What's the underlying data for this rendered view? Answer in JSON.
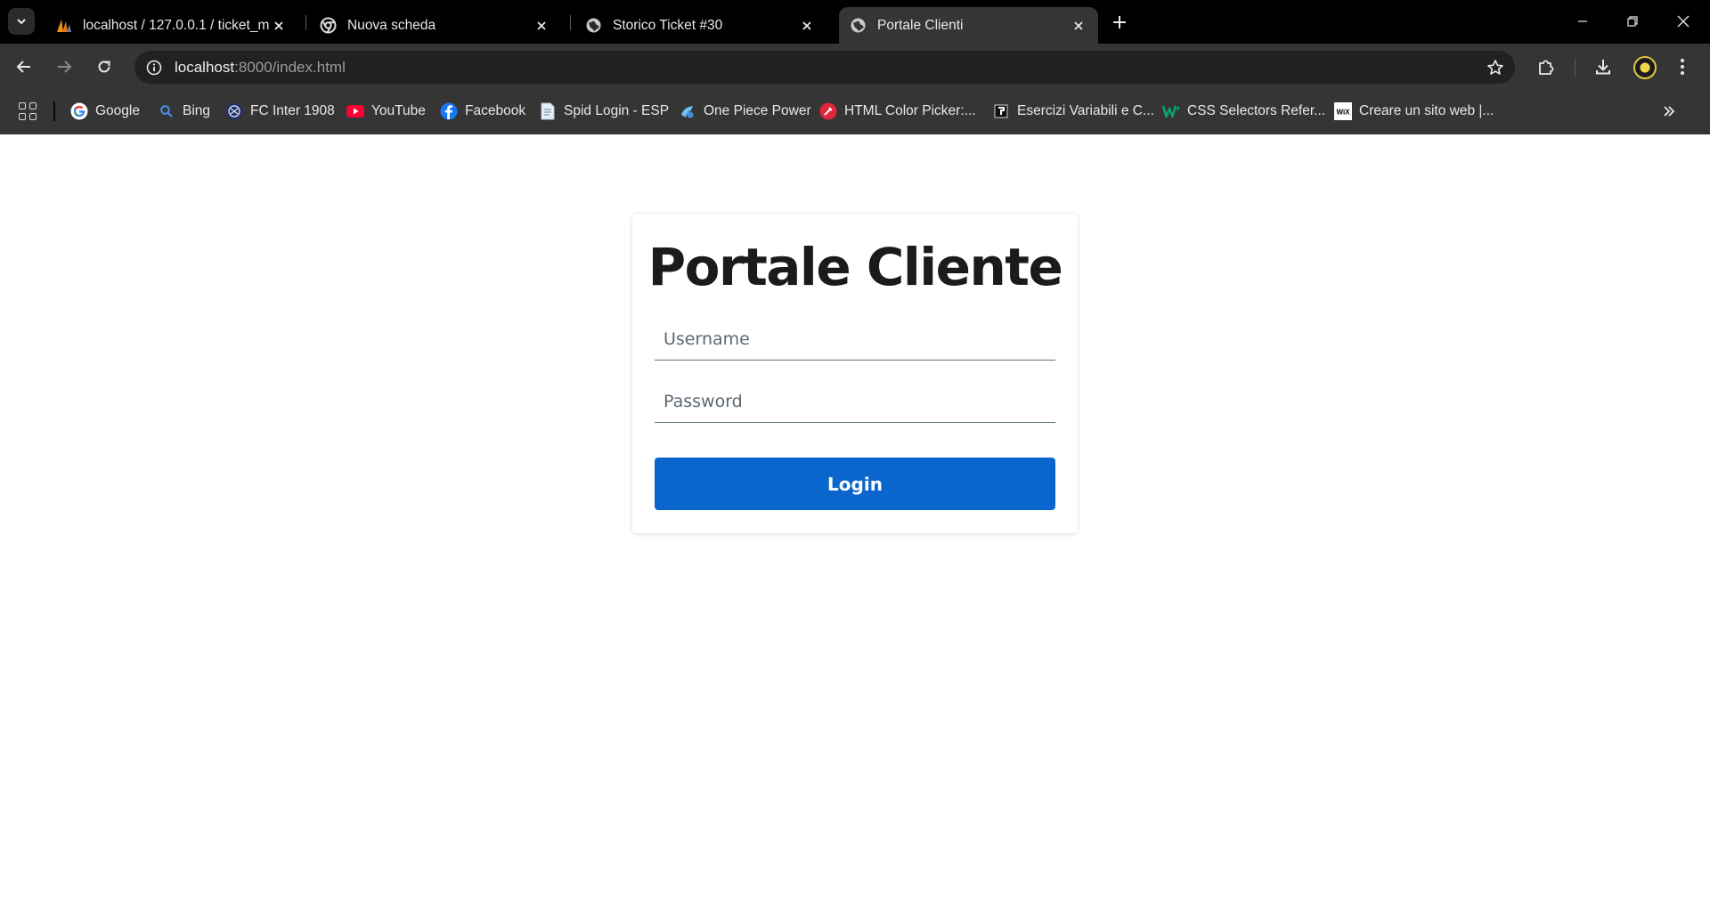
{
  "browser": {
    "tabs": [
      {
        "title": "localhost / 127.0.0.1 / ticket_ma",
        "icon": "phpmyadmin-sails-icon",
        "active": false
      },
      {
        "title": "Nuova scheda",
        "icon": "chrome-icon",
        "active": false
      },
      {
        "title": "Storico Ticket #30",
        "icon": "globe-icon",
        "active": false
      },
      {
        "title": "Portale Clienti",
        "icon": "globe-icon",
        "active": true
      }
    ],
    "url": {
      "host": "localhost",
      "path": ":8000/index.html"
    },
    "bookmarks": [
      {
        "label": "Google",
        "icon": "google-icon"
      },
      {
        "label": "Bing",
        "icon": "bing-search-icon"
      },
      {
        "label": "FC Inter 1908",
        "icon": "inter-crest-icon"
      },
      {
        "label": "YouTube",
        "icon": "youtube-icon"
      },
      {
        "label": "Facebook",
        "icon": "facebook-icon"
      },
      {
        "label": "Spid Login - ESP",
        "icon": "document-icon"
      },
      {
        "label": "One Piece Power",
        "icon": "one-piece-icon"
      },
      {
        "label": "HTML Color Picker:...",
        "icon": "color-picker-icon"
      },
      {
        "label": "Esercizi Variabili e C...",
        "icon": "black-square-icon"
      },
      {
        "label": "CSS Selectors Refer...",
        "icon": "w3schools-icon"
      },
      {
        "label": "Creare un sito web |...",
        "icon": "wix-icon"
      }
    ]
  },
  "login": {
    "title": "Portale Cliente",
    "username_placeholder": "Username",
    "password_placeholder": "Password",
    "button_label": "Login"
  },
  "colors": {
    "accent": "#0a66cc",
    "chrome_dark": "#353535"
  }
}
